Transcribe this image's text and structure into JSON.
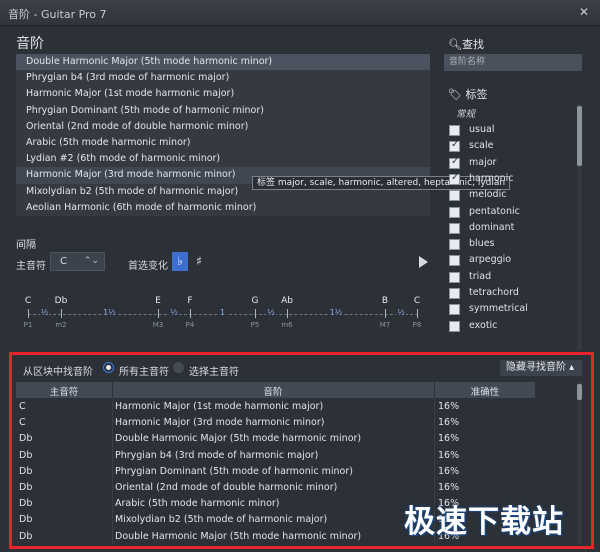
{
  "window": {
    "title": "音阶 - Guitar Pro 7",
    "close_icon": "close-icon"
  },
  "scales": {
    "title": "音阶",
    "items": [
      "Double Harmonic Major (5th mode harmonic minor)",
      "Phrygian b4 (3rd mode of harmonic major)",
      "Harmonic Major (1st mode harmonic major)",
      "Phrygian Dominant (5th mode of harmonic minor)",
      "Oriental (2nd mode of double harmonic minor)",
      "Arabic (5th mode harmonic minor)",
      "Lydian #2 (6th mode of harmonic minor)",
      "Harmonic Major (3rd mode harmonic minor)",
      "Mixolydian b2 (5th mode of harmonic major)",
      "Aeolian Harmonic (6th mode of harmonic minor)"
    ],
    "selected_index": 0,
    "hovered_index": 7,
    "tooltip": "标签 major, scale, harmonic, altered, heptatonic, lydian"
  },
  "find": {
    "title": "查找",
    "search_placeholder": "音阶名称",
    "tags_title": "标签",
    "tag_category": "常规",
    "tags": [
      {
        "label": "usual",
        "checked": false
      },
      {
        "label": "scale",
        "checked": true
      },
      {
        "label": "major",
        "checked": true
      },
      {
        "label": "harmonic",
        "checked": true
      },
      {
        "label": "melodic",
        "checked": false
      },
      {
        "label": "pentatonic",
        "checked": false
      },
      {
        "label": "dominant",
        "checked": false
      },
      {
        "label": "blues",
        "checked": false
      },
      {
        "label": "arpeggio",
        "checked": false
      },
      {
        "label": "triad",
        "checked": false
      },
      {
        "label": "tetrachord",
        "checked": false
      },
      {
        "label": "symmetrical",
        "checked": false
      },
      {
        "label": "exotic",
        "checked": false
      }
    ]
  },
  "intervals": {
    "title": "间隔",
    "root_label": "主音符",
    "root_value": "C",
    "accidental_label": "首选变化",
    "flat": "♭",
    "sharp": "♯",
    "notes": [
      "C",
      "Db",
      "E",
      "F",
      "G",
      "Ab",
      "B",
      "C"
    ],
    "degrees": [
      "P1",
      "m2",
      "M3",
      "P4",
      "P5",
      "m6",
      "M7",
      "P8"
    ],
    "steps": [
      "½",
      "1½",
      "½",
      "1",
      "½",
      "1½",
      "½"
    ]
  },
  "lower": {
    "from_label": "从区块中找音阶",
    "all_roots_label": "所有主音符",
    "select_root_label": "选择主音符",
    "hide_button": "隐藏寻找音阶 ▴",
    "columns": [
      "主音符",
      "音阶",
      "准确性"
    ],
    "rows": [
      [
        "C",
        "Harmonic Major (1st mode harmonic major)",
        "16%"
      ],
      [
        "C",
        "Harmonic Major (3rd mode harmonic minor)",
        "16%"
      ],
      [
        "Db",
        "Double Harmonic Major (5th mode harmonic minor)",
        "16%"
      ],
      [
        "Db",
        "Phrygian b4 (3rd mode of harmonic major)",
        "16%"
      ],
      [
        "Db",
        "Phrygian Dominant (5th mode of harmonic minor)",
        "16%"
      ],
      [
        "Db",
        "Oriental (2nd mode of double harmonic minor)",
        "16%"
      ],
      [
        "Db",
        "Arabic (5th mode harmonic minor)",
        "16%"
      ],
      [
        "Db",
        "Mixolydian b2 (5th mode of harmonic major)",
        "16%"
      ],
      [
        "Db",
        "Double Harmonic Major (5th mode harmonic minor)",
        "16%"
      ]
    ]
  },
  "watermark": "极速下载站",
  "colors": {
    "accent": "#3c6fd0",
    "highlight_frame": "#e8232a"
  }
}
